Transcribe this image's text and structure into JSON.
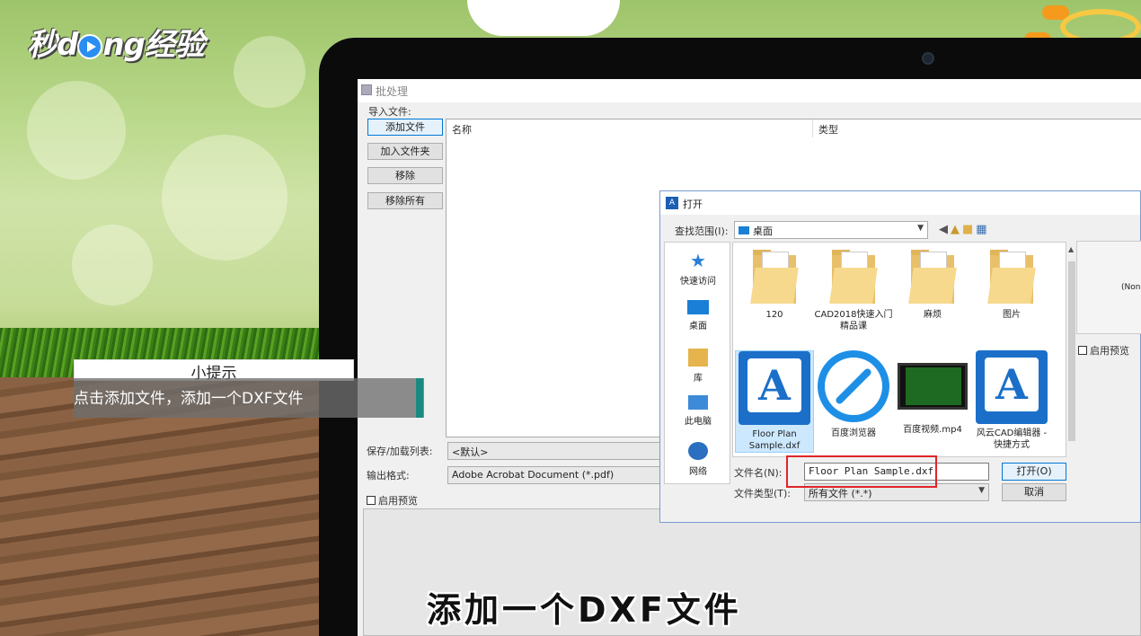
{
  "watermark": {
    "logo_text_a": "秒",
    "logo_text_b": "d",
    "logo_text_c": "ng经验"
  },
  "batch": {
    "window_title": "批处理",
    "import_label": "导入文件:",
    "add_file": "添加文件",
    "add_folder": "加入文件夹",
    "remove": "移除",
    "remove_all": "移除所有",
    "col_name": "名称",
    "col_type": "类型",
    "save_label": "保存/加载列表:",
    "save_value": "<默认>",
    "format_label": "输出格式:",
    "format_value": "Adobe Acrobat Document (*.pdf)",
    "preview_label": "启用预览"
  },
  "open_dialog": {
    "title": "打开",
    "title_icon": "A",
    "lookin_label": "查找范围(I):",
    "lookin_value": "桌面",
    "places": [
      {
        "label": "快速访问",
        "icon": "star-icon"
      },
      {
        "label": "桌面",
        "icon": "desktop-icon"
      },
      {
        "label": "库",
        "icon": "library-icon"
      },
      {
        "label": "此电脑",
        "icon": "computer-icon"
      },
      {
        "label": "网络",
        "icon": "network-icon"
      }
    ],
    "files": [
      {
        "name": "120"
      },
      {
        "name": "CAD2018快速入门精品课"
      },
      {
        "name": "麻烦"
      },
      {
        "name": "图片"
      },
      {
        "name": "Floor Plan Sample.dxf"
      },
      {
        "name": "百度浏览器"
      },
      {
        "name": "百度视频.mp4"
      },
      {
        "name": "风云CAD编辑器 - 快捷方式"
      }
    ],
    "filename_label": "文件名(N):",
    "filename_value": "Floor Plan Sample.dxf",
    "filetype_label": "文件类型(T):",
    "filetype_value": "所有文件 (*.*)",
    "open_button": "打开(O)",
    "cancel_button": "取消",
    "preview_text": "(None",
    "preview_check": "启用预览"
  },
  "tip": {
    "title": "小提示",
    "text": "点击添加文件，添加一个DXF文件"
  },
  "caption": "添加一个DXF文件"
}
